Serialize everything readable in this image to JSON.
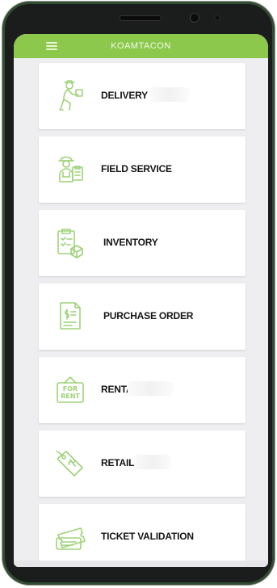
{
  "app": {
    "title": "KOAMTACON"
  },
  "menu": [
    {
      "label": "DELIVERY",
      "icon": "delivery-person-icon"
    },
    {
      "label": "FIELD SERVICE",
      "icon": "field-service-worker-icon"
    },
    {
      "label": "INVENTORY",
      "icon": "inventory-clipboard-icon"
    },
    {
      "label": "PURCHASE ORDER",
      "icon": "purchase-order-document-icon"
    },
    {
      "label": "RENTAL",
      "icon": "for-rent-sign-icon"
    },
    {
      "label": "RETAIL",
      "icon": "price-tag-icon"
    },
    {
      "label": "TICKET VALIDATION",
      "icon": "ticket-icon"
    }
  ],
  "colors": {
    "accent": "#8cc84b",
    "icon": "#9fd27a",
    "background": "#eeeef0"
  }
}
